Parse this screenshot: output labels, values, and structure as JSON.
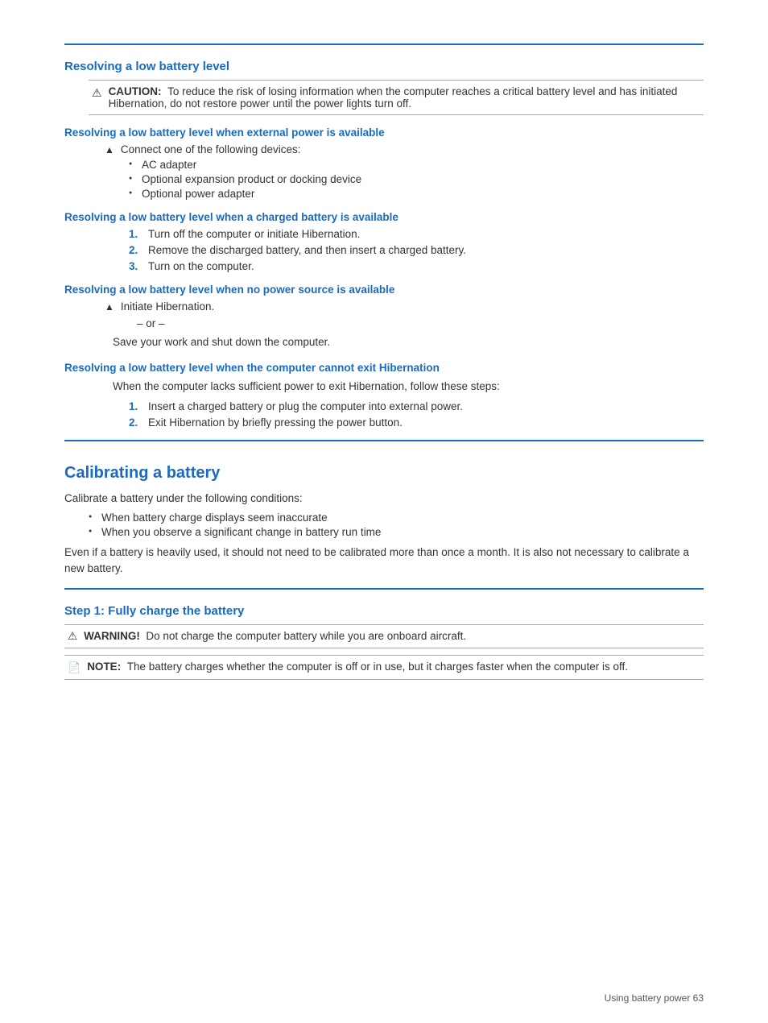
{
  "page": {
    "footer": "Using battery power    63"
  },
  "section1": {
    "heading": "Resolving a low battery level",
    "caution": {
      "label": "CAUTION:",
      "text": "To reduce the risk of losing information when the computer reaches a critical battery level and has initiated Hibernation, do not restore power until the power lights turn off."
    },
    "sub1": {
      "heading": "Resolving a low battery level when external power is available",
      "arrow_item": "Connect one of the following devices:",
      "bullets": [
        "AC adapter",
        "Optional expansion product or docking device",
        "Optional power adapter"
      ]
    },
    "sub2": {
      "heading": "Resolving a low battery level when a charged battery is available",
      "steps": [
        "Turn off the computer or initiate Hibernation.",
        "Remove the discharged battery, and then insert a charged battery.",
        "Turn on the computer."
      ]
    },
    "sub3": {
      "heading": "Resolving a low battery level when no power source is available",
      "arrow_item": "Initiate Hibernation.",
      "or": "– or –",
      "alt_text": "Save your work and shut down the computer."
    },
    "sub4": {
      "heading": "Resolving a low battery level when the computer cannot exit Hibernation",
      "intro": "When the computer lacks sufficient power to exit Hibernation, follow these steps:",
      "steps": [
        "Insert a charged battery or plug the computer into external power.",
        "Exit Hibernation by briefly pressing the power button."
      ]
    }
  },
  "section2": {
    "heading": "Calibrating a battery",
    "intro": "Calibrate a battery under the following conditions:",
    "bullets": [
      "When battery charge displays seem inaccurate",
      "When you observe a significant change in battery run time"
    ],
    "body": "Even if a battery is heavily used, it should not need to be calibrated more than once a month. It is also not necessary to calibrate a new battery."
  },
  "section3": {
    "heading": "Step 1: Fully charge the battery",
    "warning": {
      "label": "WARNING!",
      "text": "Do not charge the computer battery while you are onboard aircraft."
    },
    "note": {
      "label": "NOTE:",
      "text": "The battery charges whether the computer is off or in use, but it charges faster when the computer is off."
    }
  }
}
